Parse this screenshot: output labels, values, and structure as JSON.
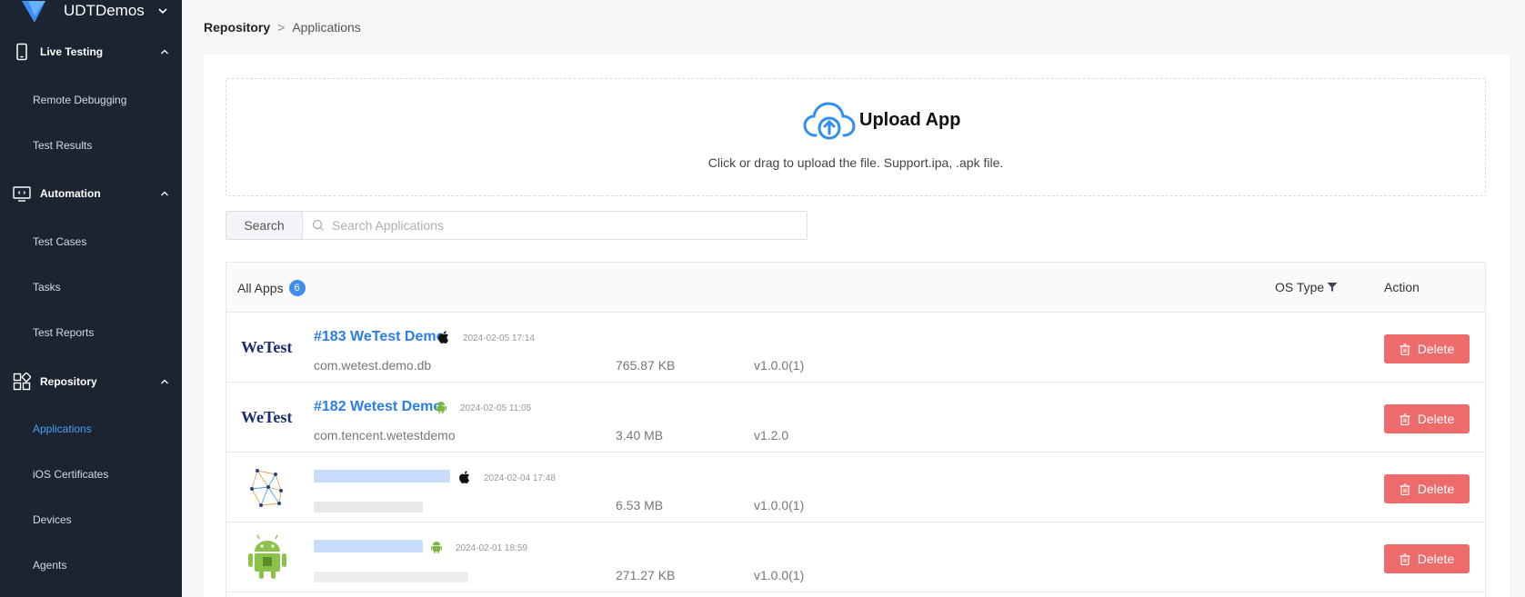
{
  "sidebar": {
    "brand": "UDTDemos",
    "groups": [
      {
        "label": "Live Testing",
        "icon": "phone-icon"
      },
      {
        "label": "Automation",
        "icon": "code-monitor-icon"
      },
      {
        "label": "Repository",
        "icon": "grid-icon"
      }
    ],
    "items": {
      "remote_debugging": "Remote Debugging",
      "test_results": "Test Results",
      "test_cases": "Test Cases",
      "tasks": "Tasks",
      "test_reports": "Test Reports",
      "applications": "Applications",
      "ios_certificates": "iOS Certificates",
      "devices": "Devices",
      "agents": "Agents"
    }
  },
  "breadcrumb": {
    "root": "Repository",
    "separator": ">",
    "current": "Applications"
  },
  "upload": {
    "title": "Upload App",
    "hint": "Click or drag to upload the file. Support.ipa, .apk file."
  },
  "search": {
    "button": "Search",
    "placeholder": "Search Applications"
  },
  "table": {
    "all_apps_label": "All Apps",
    "count": "6",
    "os_type_label": "OS Type",
    "action_label": "Action",
    "delete_label": "Delete",
    "rows": [
      {
        "name": "#183 WeTest Demo",
        "os": "ios",
        "date": "2024-02-05 17:14",
        "package": "com.wetest.demo.db",
        "size": "765.87 KB",
        "version": "v1.0.0(1)",
        "logo": "WeTest"
      },
      {
        "name": "#182 Wetest Demo",
        "os": "android",
        "date": "2024-02-05 11:05",
        "package": "com.tencent.wetestdemo",
        "size": "3.40 MB",
        "version": "v1.2.0",
        "logo": "WeTest"
      },
      {
        "name": "",
        "os": "ios",
        "date": "2024-02-04 17:48",
        "package": "",
        "size": "6.53 MB",
        "version": "v1.0.0(1)",
        "logo": ""
      },
      {
        "name": "",
        "os": "android",
        "date": "2024-02-01 18:59",
        "package": "",
        "size": "271.27 KB",
        "version": "v1.0.0(1)",
        "logo": ""
      }
    ]
  },
  "colors": {
    "sidebar_bg": "#1b2430",
    "accent": "#2b7de9",
    "danger": "#ee6b6b",
    "badge": "#3f8ef0"
  }
}
